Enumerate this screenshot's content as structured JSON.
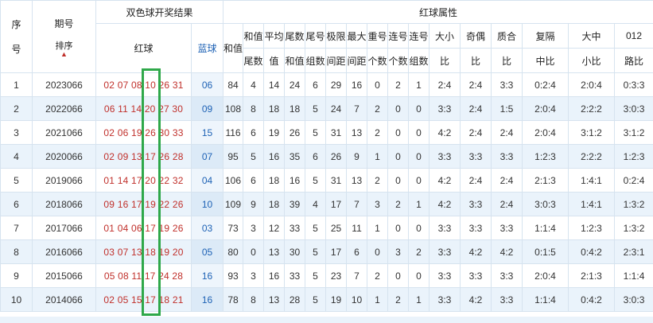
{
  "header": {
    "seq": [
      "序",
      "号"
    ],
    "issue": "期号",
    "sort": "排序",
    "group_result": "双色球开奖结果",
    "group_attr": "红球属性",
    "red": "红球",
    "blue": "蓝球",
    "attrs": [
      [
        "和值"
      ],
      [
        "和值",
        "尾数"
      ],
      [
        "平均",
        "值"
      ],
      [
        "尾数",
        "和值"
      ],
      [
        "尾号",
        "组数"
      ],
      [
        "极限",
        "间距"
      ],
      [
        "最大",
        "间距"
      ],
      [
        "重号",
        "个数"
      ],
      [
        "连号",
        "个数"
      ],
      [
        "连号",
        "组数"
      ],
      [
        "大小",
        "比"
      ],
      [
        "奇偶",
        "比"
      ],
      [
        "质合",
        "比"
      ],
      [
        "复隔",
        "中比"
      ],
      [
        "大中",
        "小比"
      ],
      [
        "012",
        "路比"
      ]
    ]
  },
  "rows": [
    {
      "n": "1",
      "issue": "2023066",
      "red": "02 07 08 10 26 31",
      "blue": "06",
      "v": [
        "84",
        "4",
        "14",
        "24",
        "6",
        "29",
        "16",
        "0",
        "2",
        "1",
        "2:4",
        "2:4",
        "3:3",
        "0:2:4",
        "2:0:4",
        "0:3:3"
      ]
    },
    {
      "n": "2",
      "issue": "2022066",
      "red": "06 11 14 20 27 30",
      "blue": "09",
      "v": [
        "108",
        "8",
        "18",
        "18",
        "5",
        "24",
        "7",
        "2",
        "0",
        "0",
        "3:3",
        "2:4",
        "1:5",
        "2:0:4",
        "2:2:2",
        "3:0:3"
      ]
    },
    {
      "n": "3",
      "issue": "2021066",
      "red": "02 06 19 26 30 33",
      "blue": "15",
      "v": [
        "116",
        "6",
        "19",
        "26",
        "5",
        "31",
        "13",
        "2",
        "0",
        "0",
        "4:2",
        "2:4",
        "2:4",
        "2:0:4",
        "3:1:2",
        "3:1:2"
      ]
    },
    {
      "n": "4",
      "issue": "2020066",
      "red": "02 09 13 17 26 28",
      "blue": "07",
      "v": [
        "95",
        "5",
        "16",
        "35",
        "6",
        "26",
        "9",
        "1",
        "0",
        "0",
        "3:3",
        "3:3",
        "3:3",
        "1:2:3",
        "2:2:2",
        "1:2:3"
      ]
    },
    {
      "n": "5",
      "issue": "2019066",
      "red": "01 14 17 20 22 32",
      "blue": "04",
      "v": [
        "106",
        "6",
        "18",
        "16",
        "5",
        "31",
        "13",
        "2",
        "0",
        "0",
        "4:2",
        "2:4",
        "2:4",
        "2:1:3",
        "1:4:1",
        "0:2:4"
      ]
    },
    {
      "n": "6",
      "issue": "2018066",
      "red": "09 16 17 19 22 26",
      "blue": "10",
      "v": [
        "109",
        "9",
        "18",
        "39",
        "4",
        "17",
        "7",
        "3",
        "2",
        "1",
        "4:2",
        "3:3",
        "2:4",
        "3:0:3",
        "1:4:1",
        "1:3:2"
      ]
    },
    {
      "n": "7",
      "issue": "2017066",
      "red": "01 04 06 17 19 26",
      "blue": "03",
      "v": [
        "73",
        "3",
        "12",
        "33",
        "5",
        "25",
        "11",
        "1",
        "0",
        "0",
        "3:3",
        "3:3",
        "3:3",
        "1:1:4",
        "1:2:3",
        "1:3:2"
      ]
    },
    {
      "n": "8",
      "issue": "2016066",
      "red": "03 07 13 18 19 20",
      "blue": "05",
      "v": [
        "80",
        "0",
        "13",
        "30",
        "5",
        "17",
        "6",
        "0",
        "3",
        "2",
        "3:3",
        "4:2",
        "4:2",
        "0:1:5",
        "0:4:2",
        "2:3:1"
      ]
    },
    {
      "n": "9",
      "issue": "2015066",
      "red": "05 08 11 17 24 28",
      "blue": "16",
      "v": [
        "93",
        "3",
        "16",
        "33",
        "5",
        "23",
        "7",
        "2",
        "0",
        "0",
        "3:3",
        "3:3",
        "3:3",
        "2:0:4",
        "2:1:3",
        "1:1:4"
      ]
    },
    {
      "n": "10",
      "issue": "2014066",
      "red": "02 05 15 17 18 21",
      "blue": "16",
      "v": [
        "78",
        "8",
        "13",
        "28",
        "5",
        "19",
        "10",
        "1",
        "2",
        "1",
        "3:3",
        "4:2",
        "3:3",
        "1:1:4",
        "0:4:2",
        "3:0:3"
      ]
    }
  ]
}
